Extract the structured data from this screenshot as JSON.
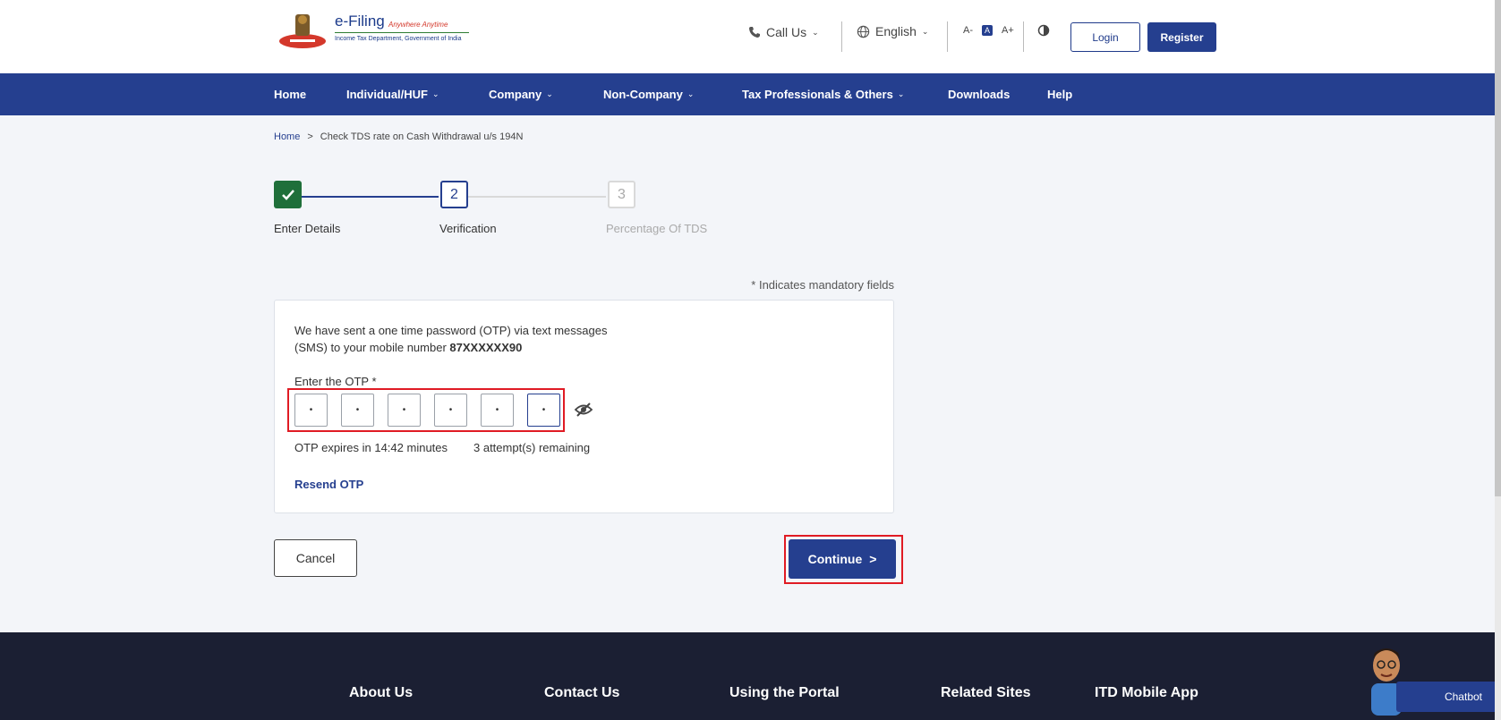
{
  "header": {
    "logo_title": "e-Filing",
    "logo_tagline": "Anywhere Anytime",
    "logo_subtitle": "Income Tax Department, Government of India",
    "call_us": "Call Us",
    "language": "English",
    "font_small": "A-",
    "font_normal": "A",
    "font_large": "A+",
    "login_label": "Login",
    "register_label": "Register"
  },
  "nav": {
    "items": [
      {
        "label": "Home"
      },
      {
        "label": "Individual/HUF"
      },
      {
        "label": "Company"
      },
      {
        "label": "Non-Company"
      },
      {
        "label": "Tax Professionals & Others"
      },
      {
        "label": "Downloads"
      },
      {
        "label": "Help"
      }
    ]
  },
  "breadcrumb": {
    "home": "Home",
    "separator": ">",
    "current": "Check TDS rate on Cash Withdrawal u/s 194N"
  },
  "stepper": {
    "steps": [
      {
        "label": "Enter Details",
        "number": "1",
        "state": "done"
      },
      {
        "label": "Verification",
        "number": "2",
        "state": "active"
      },
      {
        "label": "Percentage Of TDS",
        "number": "3",
        "state": "todo"
      }
    ]
  },
  "form": {
    "mandatory_note": "* Indicates mandatory fields",
    "message_line1": "We have sent a one time password (OTP) via text messages",
    "message_line2": "(SMS) to your mobile number",
    "mobile_masked": "87XXXXXX90",
    "otp_label": "Enter the OTP *",
    "otp_digits": [
      "•",
      "•",
      "•",
      "•",
      "•",
      "•"
    ],
    "otp_expiry": "OTP expires in 14:42 minutes",
    "attempts": "3 attempt(s) remaining",
    "resend": "Resend OTP",
    "cancel_label": "Cancel",
    "continue_label": "Continue",
    "continue_chevron": ">"
  },
  "footer": {
    "columns": [
      "About Us",
      "Contact Us",
      "Using the Portal",
      "Related Sites",
      "ITD Mobile App"
    ],
    "chatbot": "Chatbot"
  },
  "colors": {
    "primary": "#253f8f",
    "success": "#1f6f3a",
    "highlight": "#e01b24",
    "footer_bg": "#1b1f33"
  }
}
